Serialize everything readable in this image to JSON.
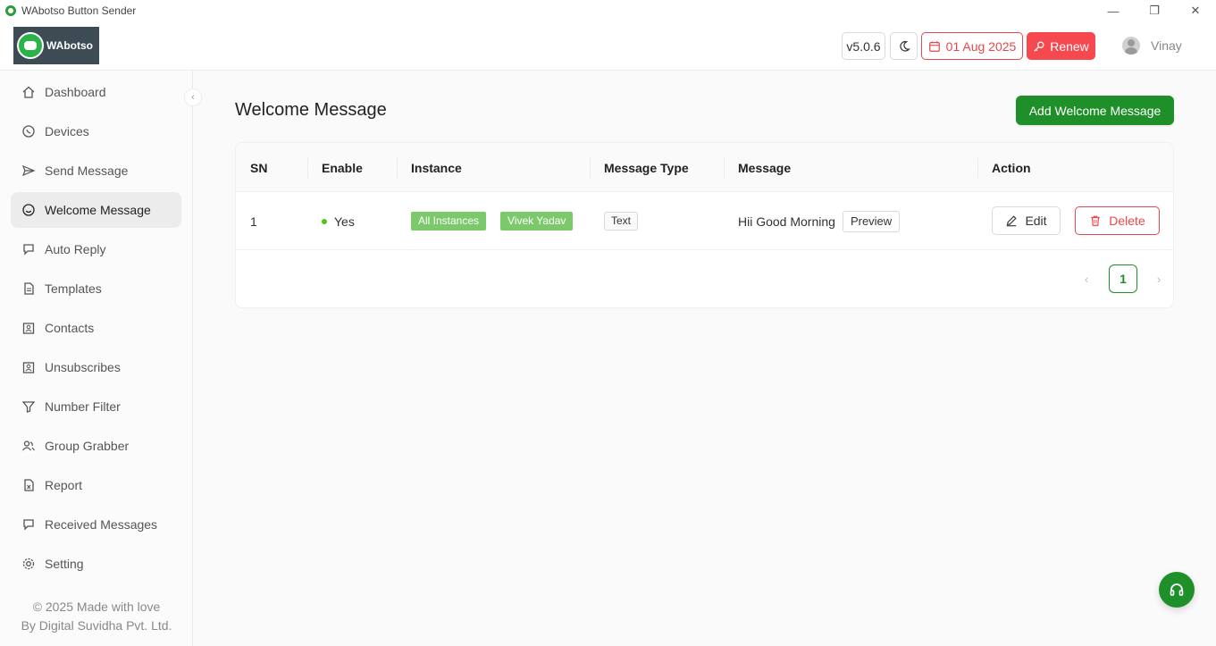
{
  "window": {
    "title": "WAbotso Button Sender",
    "controls": {
      "minimize": "—",
      "restore": "❐",
      "close": "✕"
    }
  },
  "header": {
    "logo_text": "WAbotso",
    "version": "v5.0.6",
    "expiry_date": "01 Aug 2025",
    "renew_label": "Renew",
    "user_name": "Vinay",
    "colors": {
      "danger": "#e5484d",
      "brand": "#1f8f2a"
    }
  },
  "sidebar": {
    "items": [
      {
        "label": "Dashboard",
        "icon": "home-icon"
      },
      {
        "label": "Devices",
        "icon": "whatsapp-icon"
      },
      {
        "label": "Send Message",
        "icon": "send-icon"
      },
      {
        "label": "Welcome Message",
        "icon": "smile-icon",
        "active": true
      },
      {
        "label": "Auto Reply",
        "icon": "chat-icon"
      },
      {
        "label": "Templates",
        "icon": "file-icon"
      },
      {
        "label": "Contacts",
        "icon": "contacts-icon"
      },
      {
        "label": "Unsubscribes",
        "icon": "contacts-icon"
      },
      {
        "label": "Number Filter",
        "icon": "filter-icon"
      },
      {
        "label": "Group Grabber",
        "icon": "group-icon"
      },
      {
        "label": "Report",
        "icon": "report-icon"
      },
      {
        "label": "Received Messages",
        "icon": "chat-icon"
      },
      {
        "label": "Setting",
        "icon": "gear-icon"
      }
    ],
    "footer_line1": "© 2025 Made with love",
    "footer_line2": "By Digital Suvidha Pvt. Ltd."
  },
  "main": {
    "title": "Welcome Message",
    "add_button": "Add Welcome Message",
    "table": {
      "columns": [
        "SN",
        "Enable",
        "Instance",
        "Message Type",
        "Message",
        "Action"
      ],
      "rows": [
        {
          "sn": "1",
          "enable": "Yes",
          "instances": [
            "All Instances",
            "Vivek Yadav"
          ],
          "message_type": "Text",
          "message": "Hii Good Morning",
          "preview_label": "Preview",
          "edit_label": "Edit",
          "delete_label": "Delete"
        }
      ]
    },
    "pagination": {
      "current_page": "1"
    }
  }
}
